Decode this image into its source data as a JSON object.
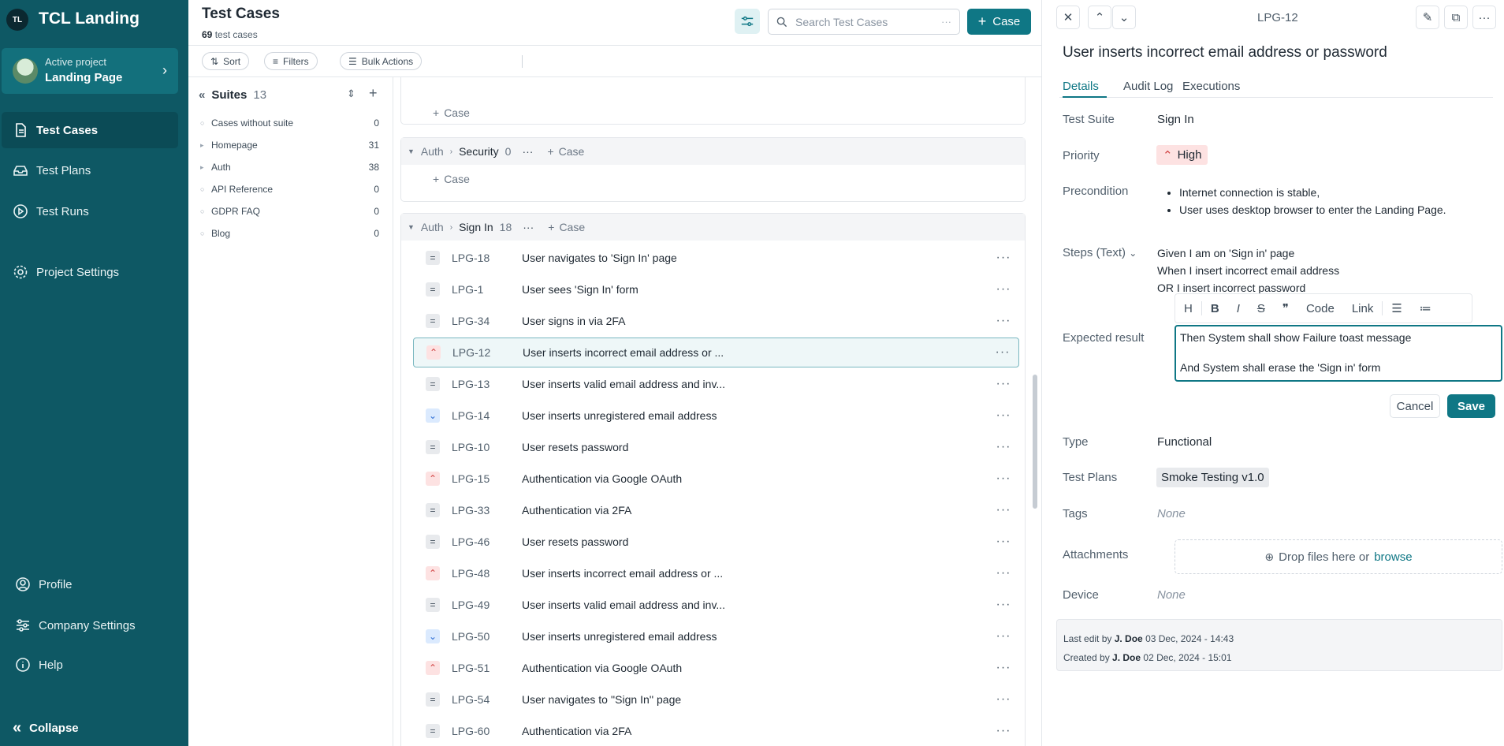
{
  "workspace": {
    "initials": "TL",
    "name": "TCL Landing"
  },
  "project": {
    "label": "Active project",
    "name": "Landing Page"
  },
  "nav": {
    "test_cases": "Test Cases",
    "test_plans": "Test Plans",
    "test_runs": "Test Runs",
    "project_settings": "Project Settings",
    "profile": "Profile",
    "company_settings": "Company Settings",
    "help": "Help",
    "collapse": "Collapse"
  },
  "header": {
    "title": "Test Cases",
    "count": "69",
    "count_suffix": "test cases",
    "search_placeholder": "Search Test Cases",
    "add_case": "Case"
  },
  "toolbar": {
    "sort": "Sort",
    "filters": "Filters",
    "bulk": "Bulk Actions"
  },
  "suites": {
    "title": "Suites",
    "count": "13",
    "items": [
      {
        "name": "Cases without suite",
        "count": "0"
      },
      {
        "name": "Homepage",
        "count": "31"
      },
      {
        "name": "Auth",
        "count": "38"
      },
      {
        "name": "API Reference",
        "count": "0"
      },
      {
        "name": "GDPR FAQ",
        "count": "0"
      },
      {
        "name": "Blog",
        "count": "0"
      }
    ]
  },
  "groups": {
    "add_case": "Case",
    "security": {
      "parent": "Auth",
      "name": "Security",
      "count": "0"
    },
    "signin": {
      "parent": "Auth",
      "name": "Sign In",
      "count": "18"
    }
  },
  "cases": [
    {
      "id": "LPG-18",
      "title": "User navigates to 'Sign In' page",
      "priority": "medium"
    },
    {
      "id": "LPG-1",
      "title": "User sees 'Sign In' form",
      "priority": "medium"
    },
    {
      "id": "LPG-34",
      "title": "User signs in via 2FA",
      "priority": "medium"
    },
    {
      "id": "LPG-12",
      "title": "User inserts incorrect email address or ...",
      "priority": "high"
    },
    {
      "id": "LPG-13",
      "title": "User inserts valid email address and inv...",
      "priority": "medium"
    },
    {
      "id": "LPG-14",
      "title": "User inserts unregistered email address",
      "priority": "low"
    },
    {
      "id": "LPG-10",
      "title": "User resets password",
      "priority": "medium"
    },
    {
      "id": "LPG-15",
      "title": "Authentication via Google OAuth",
      "priority": "high"
    },
    {
      "id": "LPG-33",
      "title": "Authentication via 2FA",
      "priority": "medium"
    },
    {
      "id": "LPG-46",
      "title": "User resets password",
      "priority": "medium"
    },
    {
      "id": "LPG-48",
      "title": "User inserts incorrect email address or ...",
      "priority": "high"
    },
    {
      "id": "LPG-49",
      "title": "User inserts valid email address and inv...",
      "priority": "medium"
    },
    {
      "id": "LPG-50",
      "title": "User inserts unregistered email address",
      "priority": "low"
    },
    {
      "id": "LPG-51",
      "title": "Authentication via Google OAuth",
      "priority": "high"
    },
    {
      "id": "LPG-54",
      "title": "User navigates to ''Sign In'' page",
      "priority": "medium"
    },
    {
      "id": "LPG-60",
      "title": "Authentication via 2FA",
      "priority": "medium"
    }
  ],
  "detail": {
    "id": "LPG-12",
    "title": "User inserts incorrect email address or password",
    "tabs": [
      "Details",
      "Audit Log",
      "Executions"
    ],
    "labels": {
      "suite": "Test Suite",
      "priority": "Priority",
      "precondition": "Precondition",
      "steps": "Steps (Text)",
      "expected": "Expected result",
      "type": "Type",
      "plans": "Test Plans",
      "tags": "Tags",
      "attachments": "Attachments",
      "device": "Device"
    },
    "suite": "Sign In",
    "priority": "High",
    "preconditions": [
      "Internet connection is stable,",
      "User uses desktop browser to enter the Landing Page."
    ],
    "steps": [
      "Given I am on 'Sign in' page",
      "When I insert incorrect email address",
      "OR I insert incorrect password"
    ],
    "editor_tools": {
      "code": "Code",
      "link": "Link"
    },
    "expected_lines": [
      "Then System shall show Failure toast message",
      "And System shall erase the 'Sign in' form"
    ],
    "cancel": "Cancel",
    "save": "Save",
    "type": "Functional",
    "plan": "Smoke Testing v1.0",
    "tags": "None",
    "drop_text": "Drop files here or",
    "browse": "browse",
    "device": "None",
    "last_edit_prefix": "Last edit by",
    "last_edit_user": "J. Doe",
    "last_edit_date": "03 Dec, 2024 - 14:43",
    "created_prefix": "Created by",
    "created_user": "J. Doe",
    "created_date": "02 Dec, 2024 - 15:01"
  },
  "colors": {
    "sidebar": "#0e5864",
    "accent": "#0f7785",
    "high": "#d14343",
    "low": "#2f6fd6"
  }
}
